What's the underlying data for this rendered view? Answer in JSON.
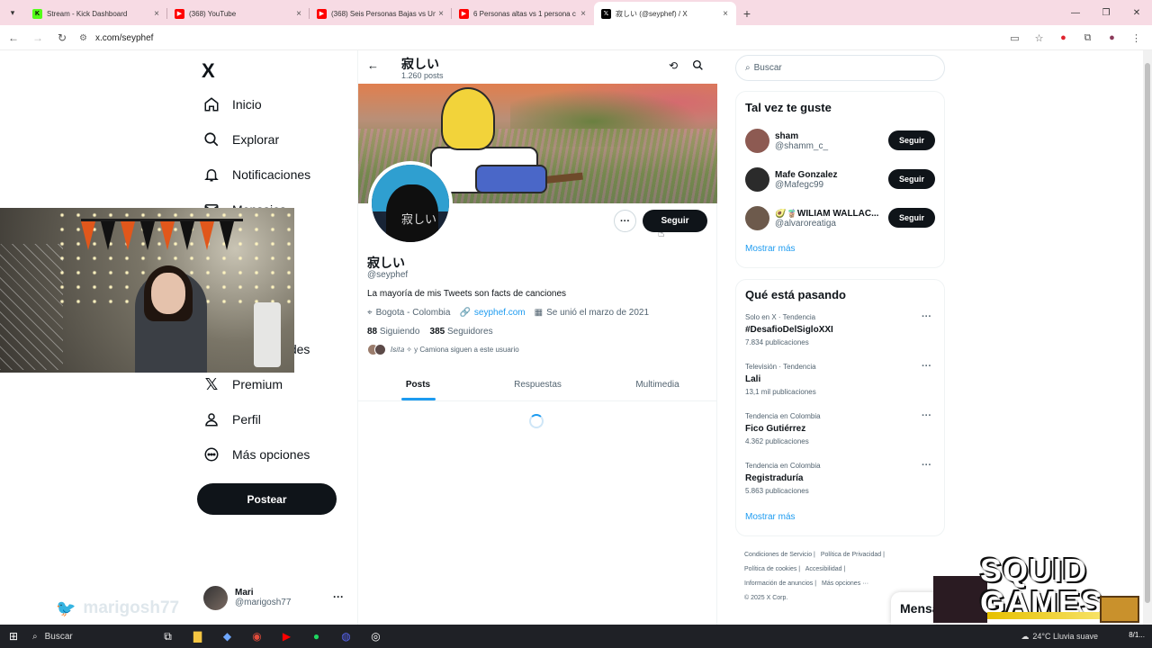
{
  "browser": {
    "tabs": [
      {
        "title": "Stream - Kick Dashboard",
        "icon": "kick-icon",
        "color": "#53fc18"
      },
      {
        "title": "(368) YouTube",
        "icon": "youtube-icon",
        "color": "#ff0000"
      },
      {
        "title": "(368) Seis Personas Bajas vs Un",
        "icon": "youtube-icon",
        "color": "#ff0000"
      },
      {
        "title": "6 Personas altas vs 1 persona c",
        "icon": "youtube-icon",
        "color": "#ff0000"
      },
      {
        "title": "寂しい (@seyphef) / X",
        "icon": "x-icon",
        "color": "#000000"
      }
    ],
    "url": "x.com/seyphef"
  },
  "nav": {
    "logo": "X",
    "items": [
      {
        "label": "Inicio",
        "icon": "home-icon"
      },
      {
        "label": "Explorar",
        "icon": "search-icon"
      },
      {
        "label": "Notificaciones",
        "icon": "bell-icon"
      },
      {
        "label": "Mensajes",
        "icon": "mail-icon"
      },
      {
        "label": "Comunidades",
        "icon": "communities-icon"
      },
      {
        "label": "Premium",
        "icon": "x-icon"
      },
      {
        "label": "Perfil",
        "icon": "person-icon"
      },
      {
        "label": "Más opciones",
        "icon": "more-circle-icon"
      }
    ],
    "post_label": "Postear",
    "account": {
      "name": "Mari",
      "handle": "@marigosh77"
    }
  },
  "watermark": "marigosh77",
  "profile": {
    "header_name": "寂しい",
    "posts_count": "1.260 posts",
    "avatar_kanji": "寂しい",
    "display_name": "寂しい",
    "handle": "@seyphef",
    "bio": "La mayoría de mis Tweets son facts de canciones",
    "location": "Bogota - Colombia",
    "website": "seyphef.com",
    "joined": "Se unió el marzo de 2021",
    "following_count": "88",
    "following_label": "Siguiendo",
    "followers_count": "385",
    "followers_label": "Seguidores",
    "followed_by": "𝐼𝑠𝑖𝑡𝑎 ✧ y Camiona siguen a este usuario",
    "follow_label": "Seguir",
    "tabs": [
      "Posts",
      "Respuestas",
      "Multimedia"
    ]
  },
  "sidebar": {
    "search_placeholder": "Buscar",
    "suggest_title": "Tal vez te guste",
    "suggestions": [
      {
        "name": "sham",
        "handle": "@shamm_c_",
        "color": "#8d5a52"
      },
      {
        "name": "Mafe Gonzalez",
        "handle": "@Mafegc99",
        "color": "#2b2b2b"
      },
      {
        "name": "🥑🧋WILIAM WALLAC...",
        "handle": "@alvaroreatiga",
        "color": "#6d5a4c"
      }
    ],
    "follow_label": "Seguir",
    "show_more": "Mostrar más",
    "trends_title": "Qué está pasando",
    "trends": [
      {
        "context": "Solo en X · Tendencia",
        "topic": "#DesafioDelSigloXXI",
        "count": "7.834 publicaciones"
      },
      {
        "context": "Televisión · Tendencia",
        "topic": "Lali",
        "count": "13,1 mil publicaciones"
      },
      {
        "context": "Tendencia en Colombia",
        "topic": "Fico Gutiérrez",
        "count": "4.362 publicaciones"
      },
      {
        "context": "Tendencia en Colombia",
        "topic": "Registraduría",
        "count": "5.863 publicaciones"
      }
    ],
    "trends_more": "Mostrar más",
    "footer": [
      "Condiciones de Servicio |",
      "Política de Privacidad |",
      "Política de cookies |",
      "Accesibilidad |",
      "Información de anuncios |",
      "Más opciones ···",
      "© 2025 X Corp."
    ]
  },
  "overlay": {
    "squid_text_line1": "SQUID",
    "squid_text_line2": "GAMES",
    "messages_label": "Mensa"
  },
  "taskbar": {
    "search_label": "Buscar",
    "weather": "24°C  Lluvia suave",
    "clock": "8/1..."
  }
}
